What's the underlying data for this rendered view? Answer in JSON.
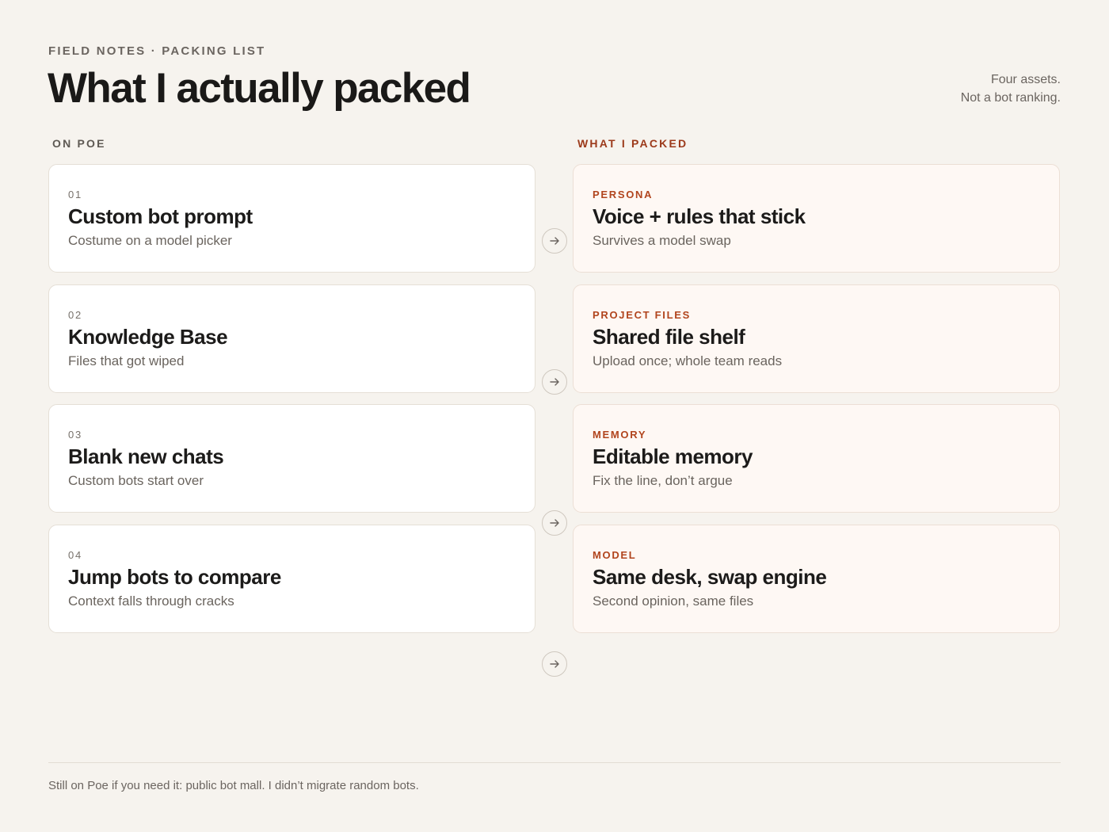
{
  "header": {
    "eyebrow": "FIELD NOTES · PACKING LIST",
    "title": "What I actually packed",
    "note_line1": "Four assets.",
    "note_line2": "Not a bot ranking."
  },
  "columns": {
    "left_label": "ON POE",
    "right_label": "WHAT I PACKED"
  },
  "left_cards": [
    {
      "number": "01",
      "title": "Custom bot prompt",
      "subtitle": "Costume on a model picker"
    },
    {
      "number": "02",
      "title": "Knowledge Base",
      "subtitle": "Files that got wiped"
    },
    {
      "number": "03",
      "title": "Blank new chats",
      "subtitle": "Custom bots start over"
    },
    {
      "number": "04",
      "title": "Jump bots to compare",
      "subtitle": "Context falls through cracks"
    }
  ],
  "right_cards": [
    {
      "tag": "PERSONA",
      "title": "Voice + rules that stick",
      "subtitle": "Survives a model swap"
    },
    {
      "tag": "PROJECT FILES",
      "title": "Shared file shelf",
      "subtitle": "Upload once; whole team reads"
    },
    {
      "tag": "MEMORY",
      "title": "Editable memory",
      "subtitle": "Fix the line, don’t argue"
    },
    {
      "tag": "MODEL",
      "title": "Same desk, swap engine",
      "subtitle": "Second opinion, same files"
    }
  ],
  "icons": {
    "arrow": "arrow-right-icon"
  },
  "colors": {
    "background": "#f6f3ee",
    "accent": "#b1451e",
    "accent_label": "#9c3a1b",
    "right_card_bg": "#fef8f4"
  },
  "footer": {
    "note": "Still on Poe if you need it: public bot mall. I didn’t migrate random bots."
  }
}
